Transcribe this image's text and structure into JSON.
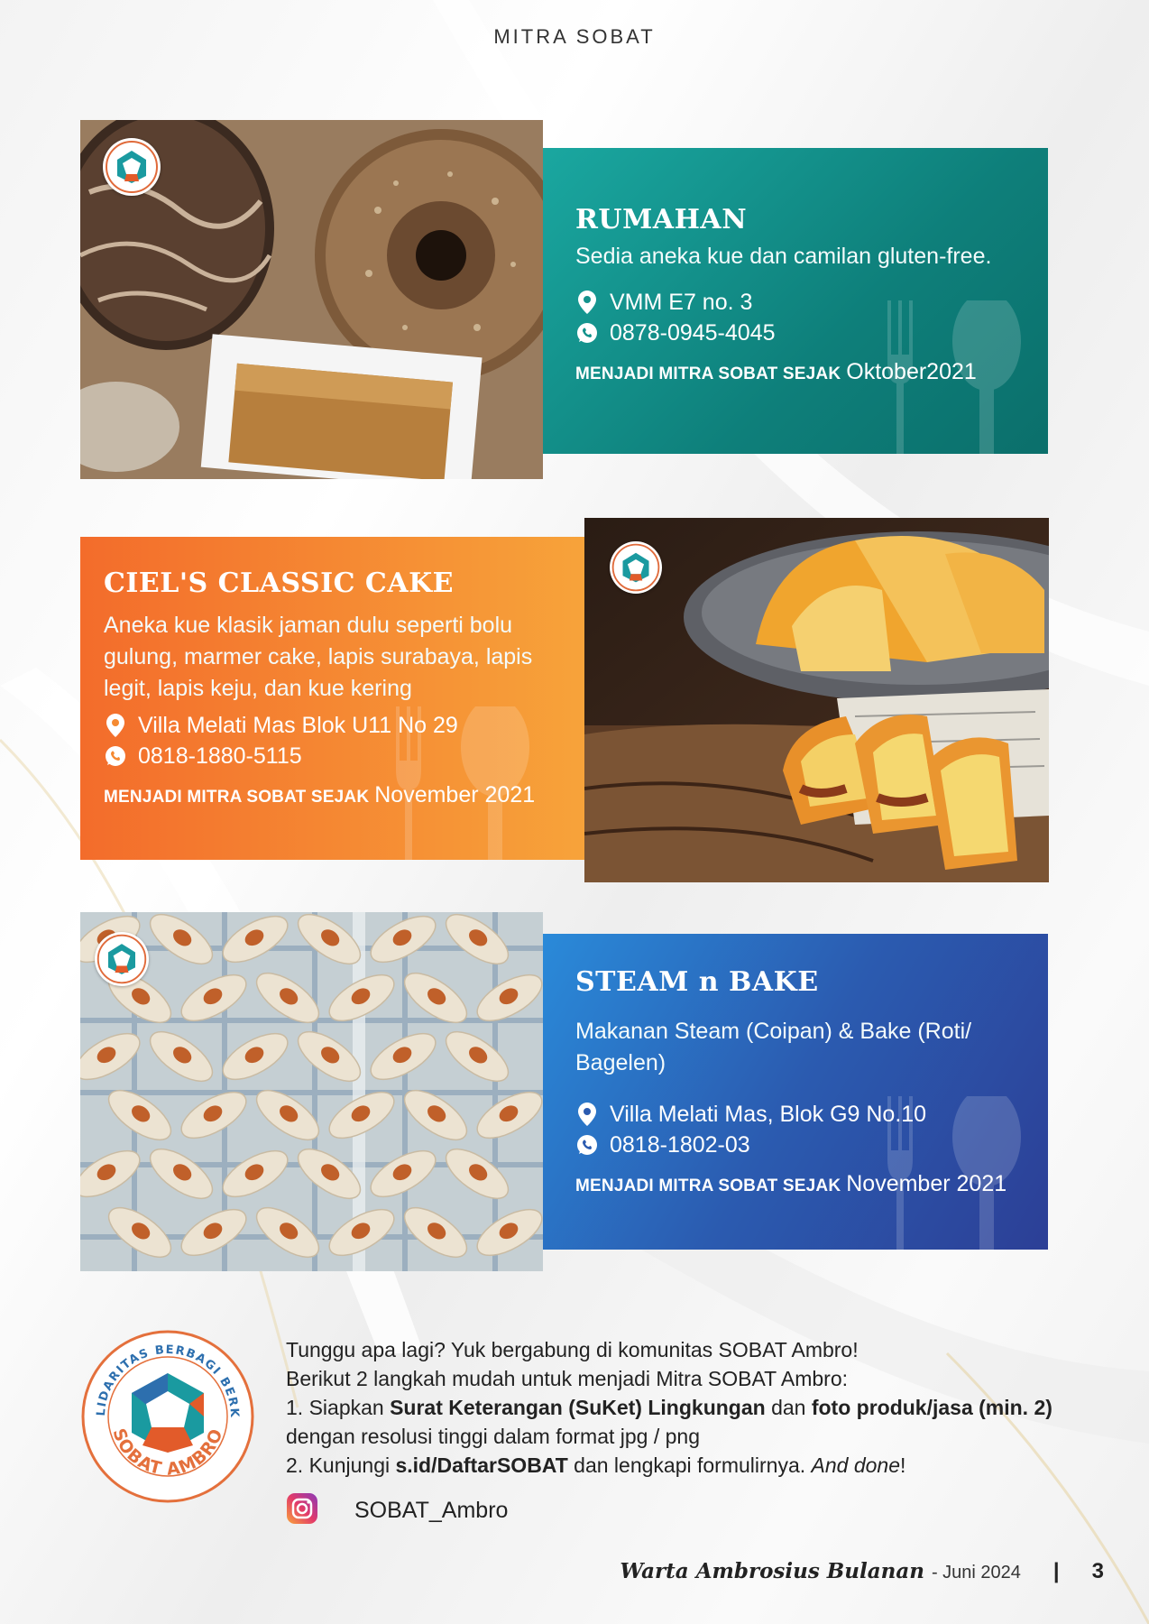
{
  "header": {
    "title": "MITRA SOBAT"
  },
  "listings": [
    {
      "name": "RUMAHAN",
      "description": "Sedia aneka kue dan camilan gluten-free.",
      "address": "VMM E7 no. 3",
      "phone": "0878-0945-4045",
      "since_label": "MENJADI MITRA SOBAT SEJAK",
      "since_date": "Oktober2021",
      "accent": "#13928c"
    },
    {
      "name": "CIEL'S CLASSIC CAKE",
      "description": "Aneka kue klasik jaman dulu seperti bolu gulung, marmer cake, lapis surabaya, lapis legit, lapis keju, dan kue kering",
      "address": "Villa Melati Mas Blok U11 No 29",
      "phone": "0818-1880-5115",
      "since_label": "MENJADI MITRA SOBAT SEJAK",
      "since_date": "November 2021",
      "accent": "#f58a32"
    },
    {
      "name": "STEAM n BAKE",
      "description": "Makanan Steam (Coipan) & Bake (Roti/ Bagelen)",
      "address": "Villa Melati Mas, Blok G9 No.10",
      "phone": "0818-1802-03",
      "since_label": "MENJADI MITRA SOBAT SEJAK",
      "since_date": "November 2021",
      "accent": "#2b5bb0"
    }
  ],
  "logo": {
    "ring_text": "SOLIDARITAS BERBAGI BERKAT",
    "bottom_text": "SOBAT AMBRO"
  },
  "info": {
    "line1": "Tunggu apa lagi? Yuk bergabung di komunitas SOBAT Ambro!",
    "line2": "Berikut 2 langkah mudah untuk menjadi Mitra SOBAT Ambro:",
    "step1_a": "1. Siapkan ",
    "step1_b": "Surat Keterangan (SuKet) Lingkungan",
    "step1_c": " dan ",
    "step1_d": "foto produk/jasa (min. 2)",
    "step1_e": "dengan resolusi tinggi dalam format jpg / png",
    "step2_a": "2. Kunjungi ",
    "step2_b": "s.id/DaftarSOBAT",
    "step2_c": " dan lengkapi formulirnya. ",
    "step2_d": "And done",
    "step2_e": "!"
  },
  "social": {
    "platform_icon": "instagram-icon",
    "handle": "SOBAT_Ambro"
  },
  "footer": {
    "magazine": "Warta Ambrosius Bulanan",
    "date": "- Juni 2024",
    "separator": "|",
    "page": "3"
  }
}
